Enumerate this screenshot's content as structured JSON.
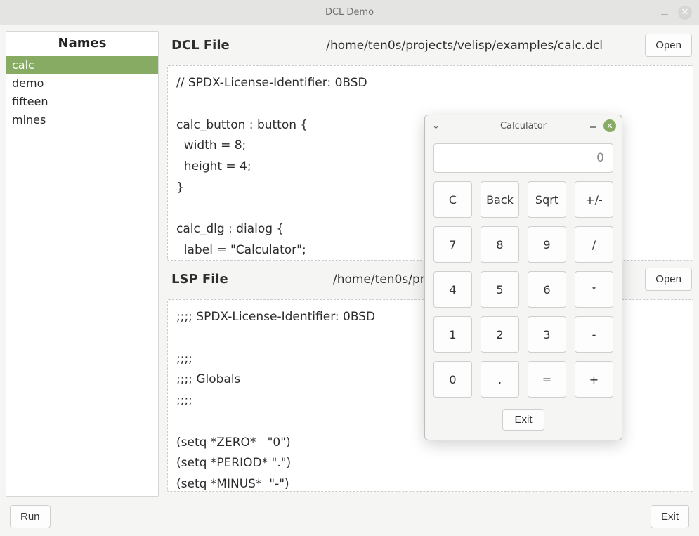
{
  "window": {
    "title": "DCL Demo"
  },
  "sidebar": {
    "header": "Names",
    "items": [
      {
        "label": "calc",
        "selected": true
      },
      {
        "label": "demo",
        "selected": false
      },
      {
        "label": "fifteen",
        "selected": false
      },
      {
        "label": "mines",
        "selected": false
      }
    ]
  },
  "dcl": {
    "label": "DCL File",
    "path": "/home/ten0s/projects/velisp/examples/calc.dcl",
    "open_label": "Open",
    "code": "// SPDX-License-Identifier: 0BSD\n\ncalc_button : button {\n  width = 8;\n  height = 4;\n}\n\ncalc_dlg : dialog {\n  label = \"Calculator\";\n  : edit_box {"
  },
  "lsp": {
    "label": "LSP File",
    "path": "/home/ten0s/projects/",
    "open_label": "Open",
    "code": ";;;; SPDX-License-Identifier: 0BSD\n\n;;;;\n;;;; Globals\n;;;;\n\n(setq *ZERO*   \"0\")\n(setq *PERIOD* \".\")\n(setq *MINUS*  \"-\")\n(setq *ERR*    \"Error\")"
  },
  "footer": {
    "run_label": "Run",
    "exit_label": "Exit"
  },
  "calculator": {
    "title": "Calculator",
    "display": "0",
    "buttons": [
      [
        "C",
        "Back",
        "Sqrt",
        "+/-"
      ],
      [
        "7",
        "8",
        "9",
        "/"
      ],
      [
        "4",
        "5",
        "6",
        "*"
      ],
      [
        "1",
        "2",
        "3",
        "-"
      ],
      [
        "0",
        ".",
        "=",
        "+"
      ]
    ],
    "exit_label": "Exit"
  }
}
